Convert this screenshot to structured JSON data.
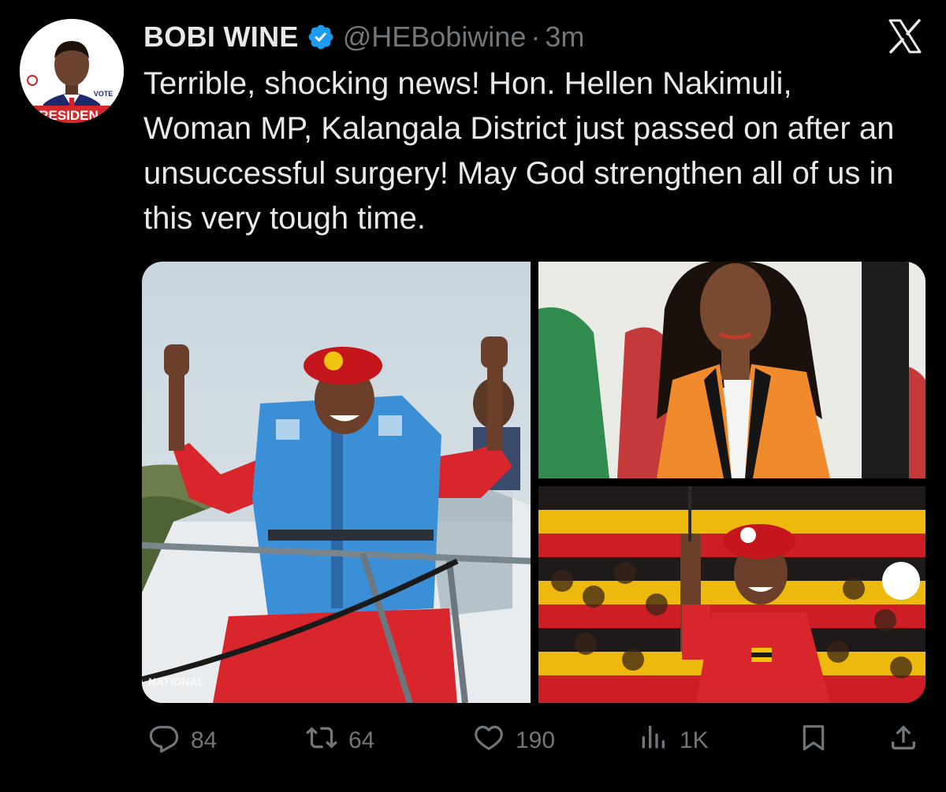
{
  "author": {
    "name": "BOBI WINE",
    "handle": "@HEBobiwine",
    "separator": "·",
    "time": "3m",
    "avatar_banner_text": "RESIDEN",
    "avatar_badge_text": "VOTE"
  },
  "tweet": {
    "text": "Terrible, shocking news! Hon. Hellen Nakimuli, Woman MP, Kalangala District just passed on after an unsuccessful surgery! May God strengthen all of us in this very tough time."
  },
  "media": {
    "left_watermark": "NATIONAL"
  },
  "actions": {
    "replies": "84",
    "reposts": "64",
    "likes": "190",
    "views": "1K"
  },
  "icons": {
    "verified": "verified-badge-icon",
    "platform": "x-logo-icon",
    "reply": "reply-icon",
    "repost": "repost-icon",
    "like": "heart-icon",
    "views": "views-chart-icon",
    "bookmark": "bookmark-icon",
    "share": "share-icon"
  },
  "colors": {
    "background": "#000000",
    "text": "#e7e9ea",
    "muted": "#71767b",
    "verified": "#1d9bf0"
  }
}
